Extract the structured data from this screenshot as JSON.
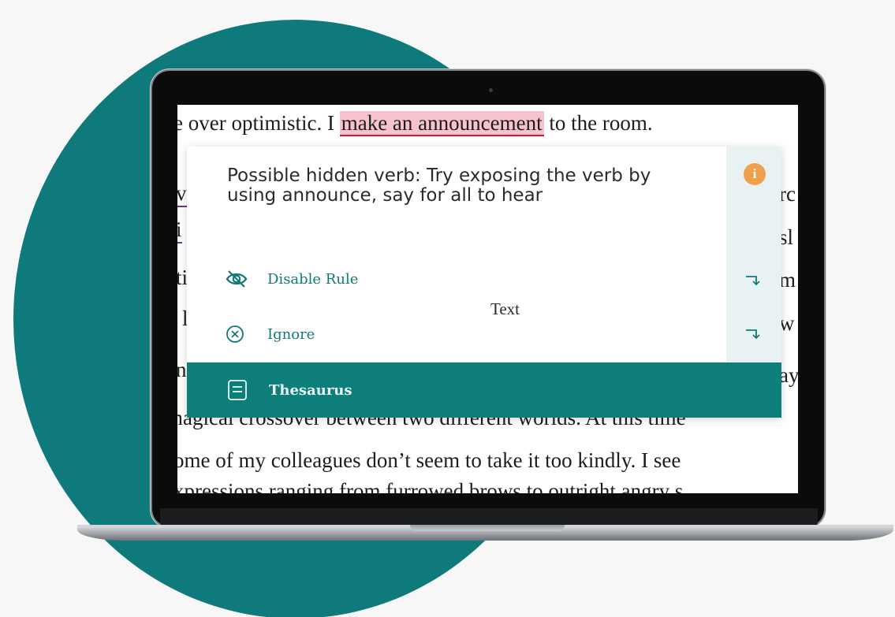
{
  "document": {
    "line1_before": "e over optimistic. I ",
    "line1_highlight": "make an announcement",
    "line1_after": " to the room.",
    "right_frags": [
      "rc",
      "sl",
      "m",
      "w",
      "ay"
    ],
    "left_frags": [
      "v",
      "i",
      "ti",
      "l",
      "n"
    ],
    "line_crossover": "magical crossover between two different worlds. At this time",
    "line_colleagues": "ome of my colleagues don’t seem to take it too kindly. I see",
    "line_expressions": "xpressions ranging from furrowed brows to outright angry s"
  },
  "popup": {
    "suggestion": "Possible hidden verb: Try exposing the verb by using announce, say for all to hear",
    "info_icon_label": "i",
    "disable_rule_label": "Disable Rule",
    "ignore_label": "Ignore",
    "center_text": "Text",
    "thesaurus_label": "Thesaurus"
  },
  "colors": {
    "brand_teal": "#0e7e7a",
    "accent_orange": "#f0a04b",
    "highlight_pink": "#f6c3cc",
    "underline_red": "#d8122f"
  },
  "icons": [
    "eye-off-icon",
    "x-circle-icon",
    "book-icon",
    "info-icon",
    "apply-arrow-icon"
  ]
}
